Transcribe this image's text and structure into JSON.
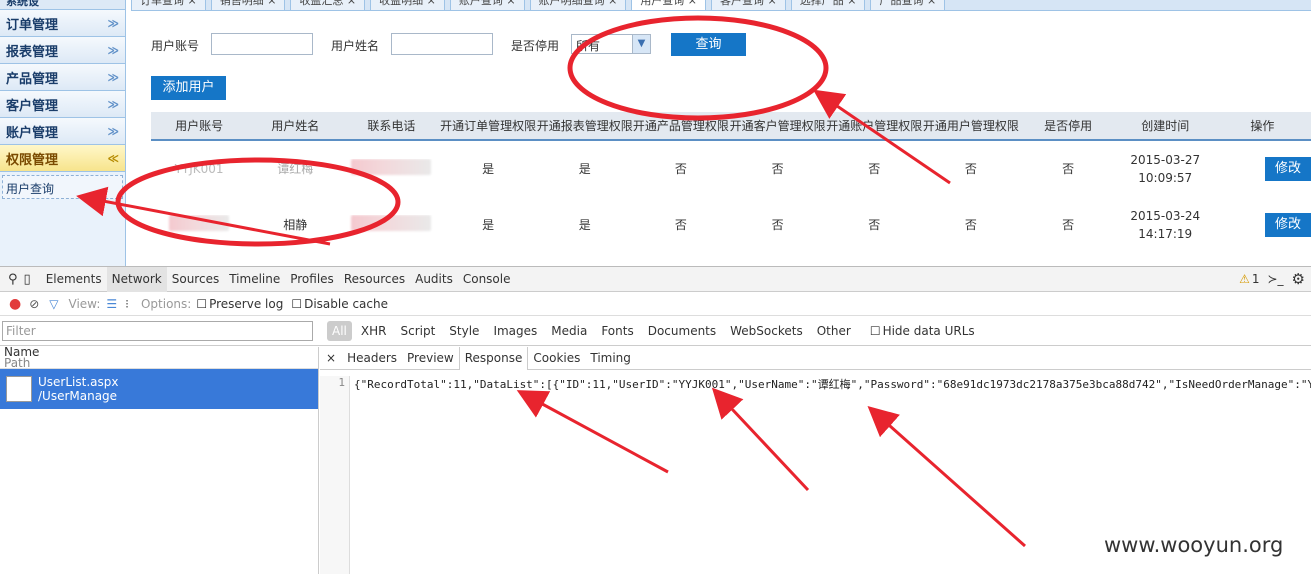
{
  "sidebar": {
    "top_label": "系统设",
    "items": [
      {
        "label": "订单管理",
        "active": false
      },
      {
        "label": "报表管理",
        "active": false
      },
      {
        "label": "产品管理",
        "active": false
      },
      {
        "label": "客户管理",
        "active": false
      },
      {
        "label": "账户管理",
        "active": false
      },
      {
        "label": "权限管理",
        "active": true
      }
    ],
    "sub_item": "用户查询"
  },
  "tabs": [
    {
      "label": "订单查询 ×",
      "active": false
    },
    {
      "label": "销售明细 ×",
      "active": false
    },
    {
      "label": "收益汇总 ×",
      "active": false
    },
    {
      "label": "收益明细 ×",
      "active": false
    },
    {
      "label": "账户查询 ×",
      "active": false
    },
    {
      "label": "账户明细查询 ×",
      "active": false
    },
    {
      "label": "用户查询 ×",
      "active": true
    },
    {
      "label": "客户查询 ×",
      "active": false
    },
    {
      "label": "选择产品 ×",
      "active": false
    },
    {
      "label": "产品查询 ×",
      "active": false
    }
  ],
  "search": {
    "account_label": "用户账号",
    "name_label": "用户姓名",
    "active_label": "是否停用",
    "active_value": "所有",
    "query_button": "查询",
    "add_button": "添加用户"
  },
  "table": {
    "headers": [
      "用户账号",
      "用户姓名",
      "联系电话",
      "开通订单管理权限",
      "开通报表管理权限",
      "开通产品管理权限",
      "开通客户管理权限",
      "开通账户管理权限",
      "开通用户管理权限",
      "是否停用",
      "创建时间",
      "操作"
    ],
    "rows": [
      {
        "account": "YYJK001",
        "name": "谭红梅",
        "order": "是",
        "report": "是",
        "product": "否",
        "customer": "否",
        "acct": "否",
        "user": "否",
        "disabled": "否",
        "date": "2015-03-27",
        "time": "10:09:57",
        "action": "修改"
      },
      {
        "account": "",
        "name": "相静",
        "order": "是",
        "report": "是",
        "product": "否",
        "customer": "否",
        "acct": "否",
        "user": "否",
        "disabled": "否",
        "date": "2015-03-24",
        "time": "14:17:19",
        "action": "修改"
      }
    ]
  },
  "devtools": {
    "panels": [
      "Elements",
      "Network",
      "Sources",
      "Timeline",
      "Profiles",
      "Resources",
      "Audits",
      "Console"
    ],
    "active_panel": "Network",
    "warning_count": "1",
    "view_label": "View:",
    "options_label": "Options:",
    "preserve_log": "Preserve log",
    "disable_cache": "Disable cache",
    "filter_placeholder": "Filter",
    "types": [
      "All",
      "XHR",
      "Script",
      "Style",
      "Images",
      "Media",
      "Fonts",
      "Documents",
      "WebSockets",
      "Other"
    ],
    "hide_data_urls": "Hide data URLs",
    "list_header_name": "Name",
    "list_header_path": "Path",
    "request_name": "UserList.aspx",
    "request_path": "/UserManage",
    "subtabs": [
      "Headers",
      "Preview",
      "Response",
      "Cookies",
      "Timing"
    ],
    "active_subtab": "Response",
    "response_line_no": "1",
    "response_text": "{\"RecordTotal\":11,\"DataList\":[{\"ID\":11,\"UserID\":\"YYJK001\",\"UserName\":\"谭红梅\",\"Password\":\"68e91dc1973dc2178a375e3bca88d742\",\"IsNeedOrderManage\":\"Y"
  },
  "watermark": "www.wooyun.org",
  "colors": {
    "accent": "#1576c7",
    "annotation": "#e8242e",
    "selection": "#3879d9"
  }
}
